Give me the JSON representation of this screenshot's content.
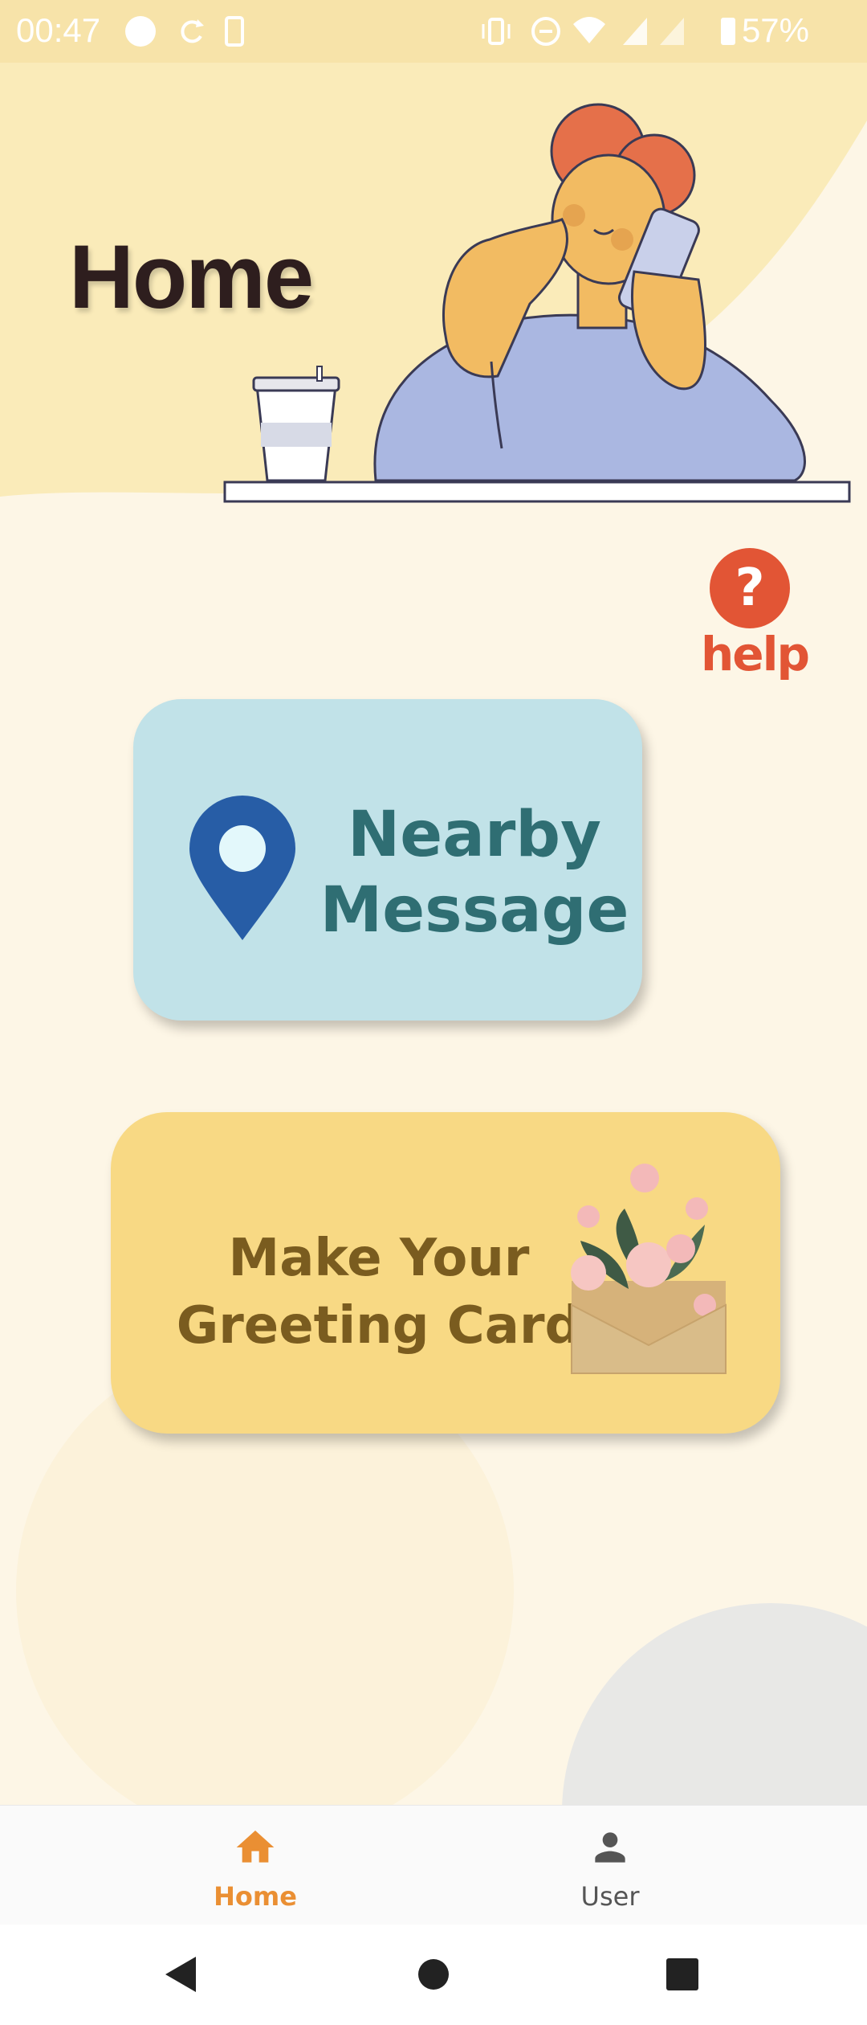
{
  "status_bar": {
    "time": "00:47",
    "battery": "57%"
  },
  "header": {
    "title": "Home"
  },
  "help": {
    "label": "help",
    "glyph": "?"
  },
  "cards": {
    "nearby": {
      "line1": "Nearby",
      "line2": "Message",
      "icon": "location-pin-icon"
    },
    "greeting": {
      "line1": "Make Your",
      "line2": "Greeting Card",
      "icon": "envelope-flowers-icon"
    }
  },
  "bottom_nav": {
    "items": [
      {
        "label": "Home",
        "icon": "home-icon",
        "active": true
      },
      {
        "label": "User",
        "icon": "user-icon",
        "active": false
      }
    ]
  },
  "colors": {
    "accent": "#EA8F33",
    "help": "#E25535",
    "nearby_bg": "#C1E2E8",
    "greeting_bg": "#F8D984"
  }
}
